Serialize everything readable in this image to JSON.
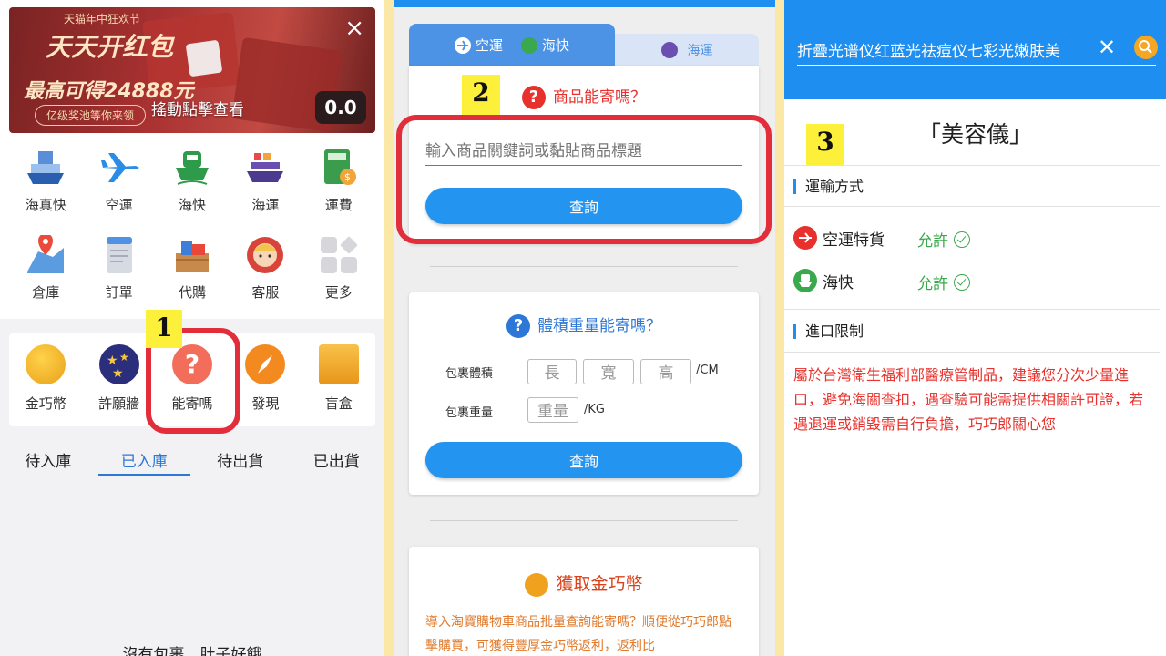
{
  "panel1": {
    "banner": {
      "small": "天猫年中狂欢节",
      "headline": "天天开红包",
      "amount": "最高可得24888元",
      "pill": "亿级奖池等你来领",
      "cta": "搖動點擊查看",
      "close": "×",
      "logo_text": "0.0"
    },
    "grid_row1": [
      "海真快",
      "空運",
      "海快",
      "海運",
      "運費"
    ],
    "grid_row2": [
      "倉庫",
      "訂單",
      "代購",
      "客服",
      "更多"
    ],
    "features": [
      "金巧幣",
      "許願牆",
      "能寄嗎",
      "發現",
      "盲盒"
    ],
    "tabs": [
      "待入庫",
      "已入庫",
      "待出貨",
      "已出貨"
    ],
    "active_tab": "已入庫",
    "empty_text": "沒有包裹，肚子好餓",
    "step": "1"
  },
  "panel2": {
    "tab_air": "空運",
    "tab_seafast": "海快",
    "tab_sea": "海運",
    "step": "2",
    "card1": {
      "title": "商品能寄嗎？",
      "placeholder": "輸入商品關鍵詞或黏貼商品標題",
      "button": "查詢"
    },
    "card2": {
      "title": "體積重量能寄嗎？",
      "volume_label": "包裹體積",
      "length": "長",
      "width": "寬",
      "height": "高",
      "volume_unit": "/CM",
      "weight_label": "包裹重量",
      "weight": "重量",
      "weight_unit": "/KG",
      "button": "查詢"
    },
    "card3": {
      "title": "獲取金巧幣",
      "text": "導入淘寶購物車商品批量查詢能寄嗎？順便從巧巧郎點擊購買，可獲得豐厚金巧幣返利，返利比"
    }
  },
  "panel3": {
    "search_query": "折疊光谱仪红蓝光祛痘仪七彩光嫩肤美",
    "step": "3",
    "title": "「美容儀」",
    "transport_title": "運輸方式",
    "modes": [
      {
        "name": "空運特貨",
        "status": "允許"
      },
      {
        "name": "海快",
        "status": "允許"
      }
    ],
    "import_title": "進口限制",
    "notice": "屬於台灣衛生福利部醫療管制品，建議您分次少量進口，避免海關查扣，遇查驗可能需提供相關許可證，若遇退運或銷毀需自行負擔，巧巧郎關心您"
  },
  "colors": {
    "primary_blue": "#1e8ef0",
    "highlight_red": "#e12e3a",
    "badge_yellow": "#fcf03a",
    "allow_green": "#3aa84c"
  }
}
